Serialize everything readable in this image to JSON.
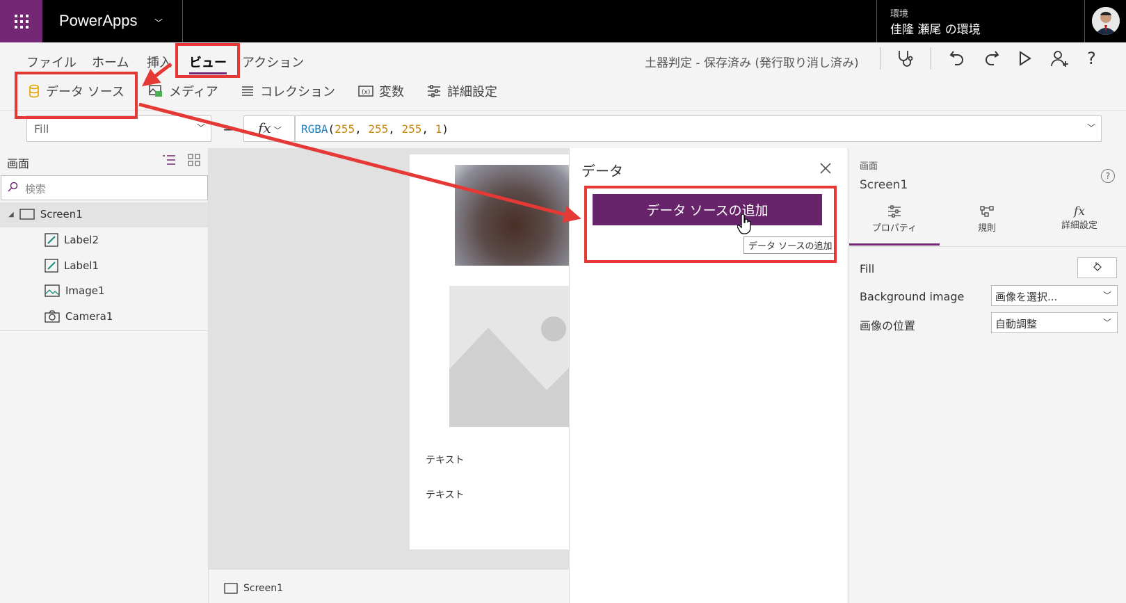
{
  "app": {
    "title": "PowerApps",
    "env_label": "環境",
    "env_name": "佳隆 瀬尾 の環境"
  },
  "menu": {
    "items": [
      "ファイル",
      "ホーム",
      "挿入",
      "ビュー",
      "アクション"
    ],
    "active": "ビュー"
  },
  "status": {
    "save_state": "土器判定 - 保存済み (発行取り消し済み)"
  },
  "ribbon": {
    "data_sources": "データ ソース",
    "media": "メディア",
    "collections": "コレクション",
    "variables": "変数",
    "advanced": "詳細設定"
  },
  "formula": {
    "property": "Fill",
    "fx": "fx",
    "fn": "RGBA",
    "open": "(",
    "args": [
      "255",
      "255",
      "255",
      "1"
    ],
    "close": ")"
  },
  "tree": {
    "title": "画面",
    "search_placeholder": "検索",
    "screen": "Screen1",
    "items": [
      "Label2",
      "Label1",
      "Image1",
      "Camera1"
    ]
  },
  "canvas": {
    "text1": "テキスト",
    "text2": "テキスト",
    "footer_screen": "Screen1"
  },
  "data_panel": {
    "title": "データ",
    "add_button": "データ ソースの追加",
    "tooltip": "データ ソースの追加"
  },
  "properties": {
    "section": "画面",
    "screen_name": "Screen1",
    "tabs": [
      "プロパティ",
      "規則",
      "詳細設定"
    ],
    "rows": [
      {
        "label": "Fill"
      },
      {
        "label": "Background image",
        "value": "画像を選択..."
      },
      {
        "label": "画像の位置",
        "value": "自動調整"
      }
    ]
  },
  "colors": {
    "accent": "#742774",
    "button": "#67246a",
    "highlight": "#e53935",
    "num": "#c8860a",
    "fn": "#1e7fbf"
  }
}
